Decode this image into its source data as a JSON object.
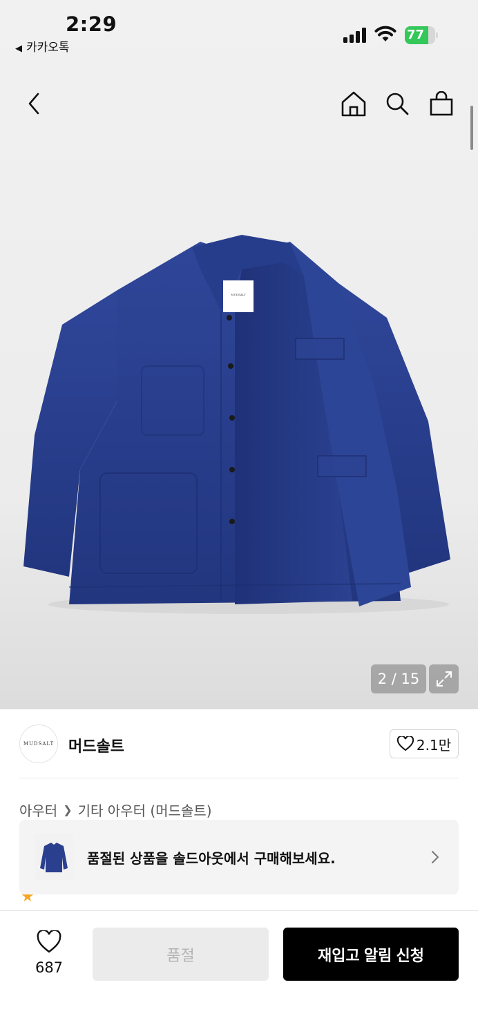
{
  "status_bar": {
    "time": "2:29",
    "back_app_label": "카카오톡",
    "battery_level": "77",
    "battery_fraction": 0.77,
    "battery_color": "#34c759"
  },
  "top_nav": {
    "icons": [
      "chevron-left-icon",
      "home-icon",
      "search-icon",
      "shopping-bag-icon"
    ]
  },
  "gallery": {
    "counter": "2 / 15",
    "product_color": "#2b3f8f",
    "tag_text": "MUDSALT"
  },
  "brand": {
    "logo_text": "MUDSALT",
    "name": "머드솔트",
    "like_count": "2.1만"
  },
  "breadcrumb": {
    "level1": "아우터",
    "level2": "기타 아우터 (머드솔트)"
  },
  "soldout_banner": {
    "text": "품절된 상품을 솔드아웃에서 구매해보세요."
  },
  "bottom_bar": {
    "wish_count": "687",
    "soldout_label": "품절",
    "restock_label": "재입고 알림 신청"
  }
}
